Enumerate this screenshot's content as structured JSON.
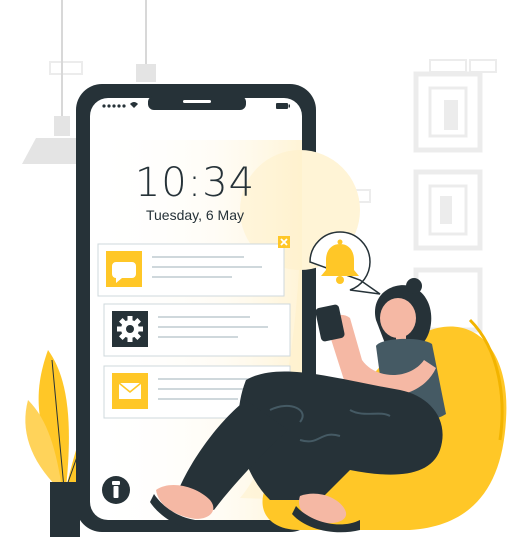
{
  "lockscreen": {
    "time": "10:34",
    "date": "Tuesday, 6 May"
  },
  "notifications": [
    {
      "icon": "chat-bubble-icon",
      "dismissible": true
    },
    {
      "icon": "gear-icon"
    },
    {
      "icon": "envelope-icon"
    }
  ],
  "colors": {
    "accent": "#FFC727",
    "dark": "#263238",
    "screen_bg": "#FFF4D6",
    "bean_bag": "#FFC727",
    "skin": "#F5B8A4"
  }
}
